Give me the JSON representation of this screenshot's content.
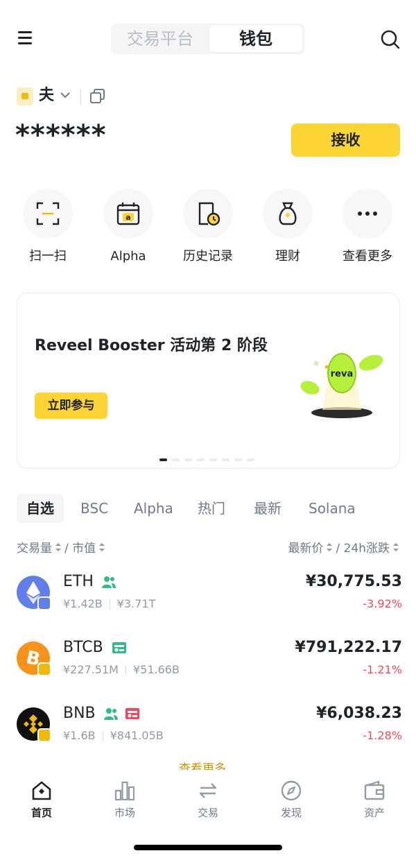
{
  "header": {
    "tabs": [
      {
        "label": "交易平台",
        "active": false
      },
      {
        "label": "钱包",
        "active": true
      }
    ],
    "icons": {
      "menu": "hamburger-menu-icon",
      "search": "search-icon"
    }
  },
  "account": {
    "name": "夫",
    "balance_masked": "******",
    "receive_label": "接收"
  },
  "quick_actions": [
    {
      "label": "扫一扫",
      "icon": "scan-icon"
    },
    {
      "label": "Alpha",
      "icon": "alpha-calendar-icon"
    },
    {
      "label": "历史记录",
      "icon": "history-icon"
    },
    {
      "label": "理财",
      "icon": "earn-bag-icon"
    },
    {
      "label": "查看更多",
      "icon": "more-icon"
    }
  ],
  "banner": {
    "title": "Reveel Booster 活动第 2 阶段",
    "button_label": "立即参与",
    "art_text": "reva",
    "page_index": 1,
    "page_count": 8
  },
  "categories": {
    "items": [
      "自选",
      "BSC",
      "Alpha",
      "热门",
      "最新",
      "Solana"
    ],
    "active_index": 0
  },
  "sort": {
    "volume": "交易量",
    "market_cap": "市值",
    "separator": "/",
    "latest_price": "最新价",
    "change_24h": "24h涨跌"
  },
  "tokens": [
    {
      "symbol": "ETH",
      "volume": "¥1.42B",
      "market_cap": "¥3.71T",
      "price": "¥30,775.53",
      "change": "-3.92%",
      "tags": [
        "holders-icon"
      ],
      "color": "#627eea"
    },
    {
      "symbol": "BTCB",
      "volume": "¥227.51M",
      "market_cap": "¥51.66B",
      "price": "¥791,222.17",
      "change": "-1.21%",
      "tags": [
        "verified-badge-icon"
      ],
      "color": "#f7931a"
    },
    {
      "symbol": "BNB",
      "volume": "¥1.6B",
      "market_cap": "¥841.05B",
      "price": "¥6,038.23",
      "change": "-1.28%",
      "tags": [
        "holders-icon",
        "alert-badge-icon"
      ],
      "color": "#f0b90b"
    }
  ],
  "view_more_label": "查看更多",
  "bottom_nav": [
    {
      "label": "首页",
      "icon": "home-icon",
      "active": true
    },
    {
      "label": "市场",
      "icon": "market-chart-icon",
      "active": false
    },
    {
      "label": "交易",
      "icon": "trade-swap-icon",
      "active": false
    },
    {
      "label": "发现",
      "icon": "discover-compass-icon",
      "active": false
    },
    {
      "label": "资产",
      "icon": "assets-wallet-icon",
      "active": false
    }
  ],
  "colors": {
    "accent": "#fcd535",
    "text": "#1e2329",
    "muted": "#707a8a",
    "negative": "#f6465d",
    "tag_green": "#2ebd85",
    "tag_red": "#f6465d"
  }
}
